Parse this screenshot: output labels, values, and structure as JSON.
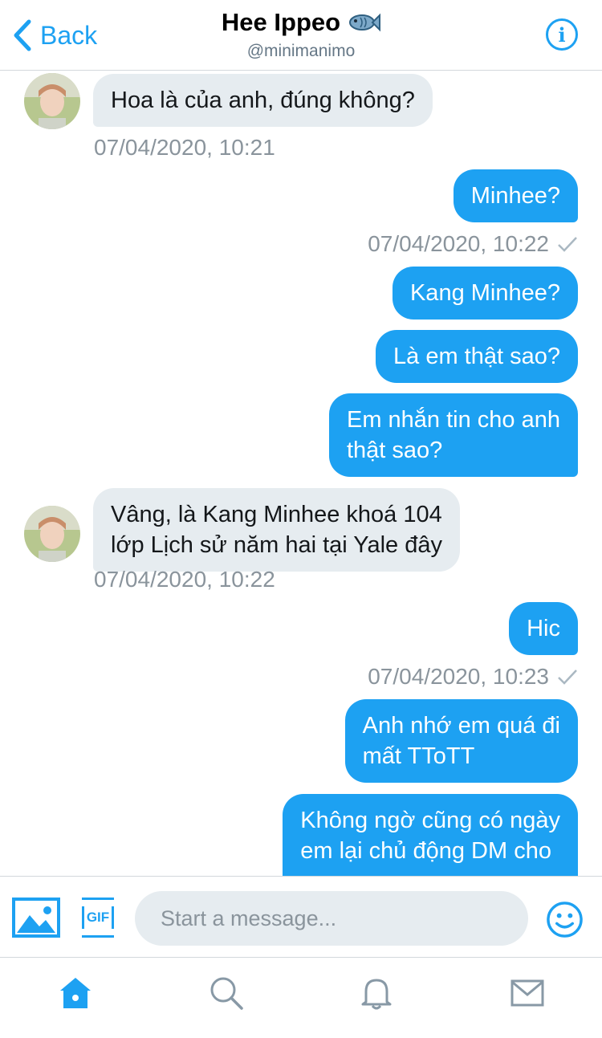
{
  "header": {
    "back_label": "Back",
    "name": "Hee Ippeo",
    "handle": "@minimanimo",
    "info_label": "i"
  },
  "messages": [
    {
      "dir": "in",
      "text": "Hoa là của anh, đúng không?"
    },
    {
      "timestamp": "07/04/2020, 10:21"
    },
    {
      "dir": "out",
      "text": "Minhee?"
    },
    {
      "timestamp": "07/04/2020, 10:22",
      "seen": true
    },
    {
      "dir": "out",
      "text": "Kang Minhee?"
    },
    {
      "dir": "out",
      "text": "Là em thật sao?"
    },
    {
      "dir": "out",
      "lines": [
        "Em nhắn tin cho anh",
        "thật sao?"
      ]
    },
    {
      "dir": "in",
      "lines": [
        "Vâng, là Kang Minhee khoá 104",
        "lớp Lịch sử năm hai tại Yale đây"
      ]
    },
    {
      "timestamp": "07/04/2020, 10:22"
    },
    {
      "dir": "out",
      "text": "Hic"
    },
    {
      "timestamp": "07/04/2020, 10:23",
      "seen": true
    },
    {
      "dir": "out",
      "lines": [
        "Anh nhớ em quá đi",
        "mất TToTT"
      ]
    },
    {
      "dir": "out",
      "lines": [
        "Không ngờ cũng có ngày",
        "em lại chủ động DM cho"
      ]
    }
  ],
  "composer": {
    "placeholder": "Start a message...",
    "gif_label": "GIF",
    "icons": [
      "image-icon",
      "gif-icon",
      "emoji-icon"
    ]
  },
  "tabs": [
    "home-icon",
    "search-icon",
    "notifications-icon",
    "messages-icon"
  ],
  "colors": {
    "accent": "#1da1f2",
    "incoming_bubble": "#e6ecf0",
    "timestamp": "#8a949c",
    "divider": "#d3d8dc"
  }
}
